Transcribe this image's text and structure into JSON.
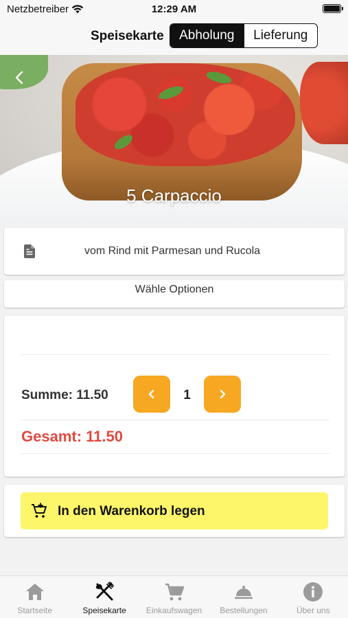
{
  "status_bar": {
    "carrier": "Netzbetreiber",
    "time": "12:29 AM",
    "battery_level": 1.0
  },
  "nav": {
    "title": "Speisekarte",
    "segments": [
      {
        "label": "Abholung",
        "active": true
      },
      {
        "label": "Lieferung",
        "active": false
      }
    ]
  },
  "product": {
    "title": "5 Carpaccio",
    "description": "vom Rind mit Parmesan und Rucola",
    "options_label": "Wähle Optionen",
    "summe_text": "Summe: 11.50",
    "quantity": "1",
    "gesamt_text": "Gesamt: 11.50",
    "add_to_cart_label": "In den Warenkorb legen"
  },
  "tabs": [
    {
      "label": "Startseite",
      "icon": "home-icon",
      "active": false
    },
    {
      "label": "Speisekarte",
      "icon": "fork-knife-icon",
      "active": true
    },
    {
      "label": "Einkaufswagen",
      "icon": "cart-icon",
      "active": false
    },
    {
      "label": "Bestellungen",
      "icon": "cloche-icon",
      "active": false
    },
    {
      "label": "Über uns",
      "icon": "info-icon",
      "active": false
    }
  ],
  "colors": {
    "quantity_button": "#f7a823",
    "gesamt": "#e04a3f",
    "cart_button": "#fdf66a",
    "tab_active": "#111111",
    "tab_inactive": "#9b9b9b"
  }
}
